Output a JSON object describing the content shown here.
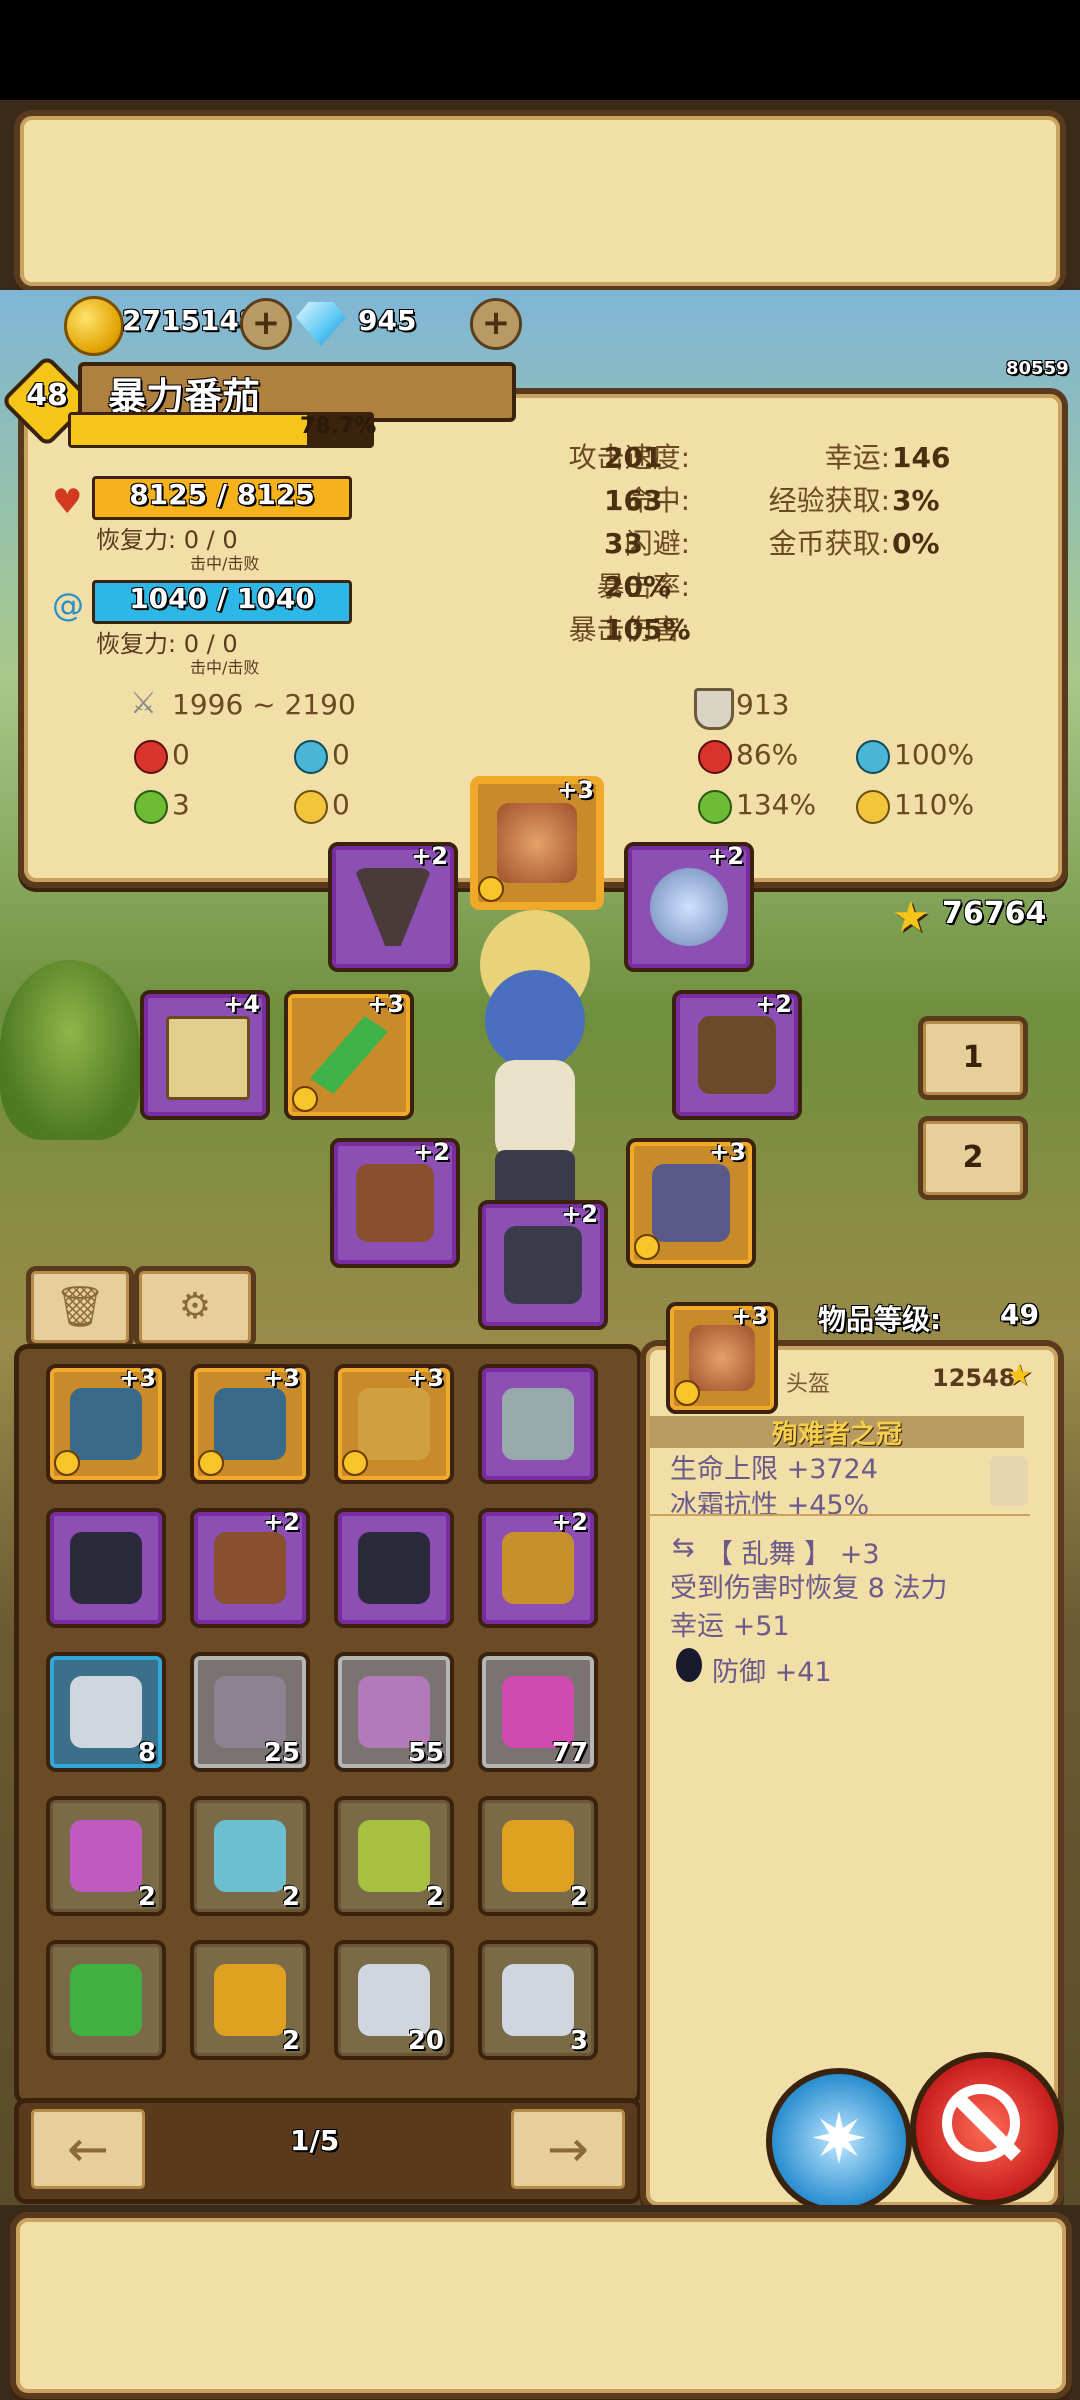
{
  "currency": {
    "gold": "2715148",
    "gems": "945",
    "id_number": "80559"
  },
  "hero": {
    "level": "48",
    "name": "暴力番茄",
    "xp_percent": "78.7%",
    "xp_fill": 0.787,
    "power": "76764"
  },
  "hp": {
    "value": "8125 / 8125",
    "regen_label": "恢复力: 0 / 0",
    "regen_sub": "击中/击败"
  },
  "mp": {
    "value": "1040 / 1040",
    "regen_label": "恢复力: 0 / 0",
    "regen_sub": "击中/击败"
  },
  "stats_mid": [
    {
      "label": "攻击速度:",
      "value": "201"
    },
    {
      "label": "命中:",
      "value": "163"
    },
    {
      "label": "闪避:",
      "value": "33"
    },
    {
      "label": "暴击率:",
      "value": "20%"
    },
    {
      "label": "暴击伤害:",
      "value": "105%"
    }
  ],
  "stats_right": [
    {
      "label": "幸运:",
      "value": "146"
    },
    {
      "label": "经验获取:",
      "value": "3%"
    },
    {
      "label": "金币获取:",
      "value": "0%"
    }
  ],
  "attack": {
    "damage": "1996 ~ 2190",
    "fire": "0",
    "ice": "0",
    "poison": "3",
    "lightning": "0"
  },
  "defense": {
    "armor": "913",
    "fire": "86%",
    "ice": "100%",
    "poison": "134%",
    "lightning": "110%"
  },
  "equipped": {
    "helmet": "+3",
    "amulet": "+2",
    "ring": "+2",
    "book": "+4",
    "weapon": "+3",
    "armor": "+2",
    "pants": "+2",
    "boots": "+2",
    "gloves": "+3"
  },
  "side_tabs": [
    "1",
    "2"
  ],
  "inventory": [
    {
      "plus": "+3",
      "count": ""
    },
    {
      "plus": "+3",
      "count": ""
    },
    {
      "plus": "+3",
      "count": ""
    },
    {
      "plus": "",
      "count": ""
    },
    {
      "plus": "",
      "count": ""
    },
    {
      "plus": "+2",
      "count": ""
    },
    {
      "plus": "",
      "count": ""
    },
    {
      "plus": "+2",
      "count": ""
    },
    {
      "plus": "",
      "count": "8"
    },
    {
      "plus": "",
      "count": "25"
    },
    {
      "plus": "",
      "count": "55"
    },
    {
      "plus": "",
      "count": "77"
    },
    {
      "plus": "",
      "count": "2"
    },
    {
      "plus": "",
      "count": "2"
    },
    {
      "plus": "",
      "count": "2"
    },
    {
      "plus": "",
      "count": "2"
    },
    {
      "plus": "",
      "count": ""
    },
    {
      "plus": "",
      "count": "2"
    },
    {
      "plus": "",
      "count": "20"
    },
    {
      "plus": "",
      "count": "3"
    }
  ],
  "pager": {
    "text": "1/5"
  },
  "detail": {
    "item_level_label": "物品等级:",
    "item_level": "49",
    "plus": "+3",
    "slot": "头盔",
    "score": "12548",
    "name": "殉难者之冠",
    "attrs": [
      "生命上限 +3724",
      "冰霜抗性 +45%"
    ],
    "affix": "【 乱舞 】 +3",
    "affix_lines": [
      "受到伤害时恢复 8 法力",
      "幸运 +51"
    ],
    "socket": "防御 +41"
  },
  "colors": {
    "parchment": "#f2dfa8",
    "frame": "#5a3a1c",
    "hp_bar": "#f6b21a",
    "mp_bar": "#2db7e6",
    "xp_bar": "#f6c51a",
    "purple_rarity": "#8c4fb4",
    "gold_rarity": "#c98b2a"
  }
}
